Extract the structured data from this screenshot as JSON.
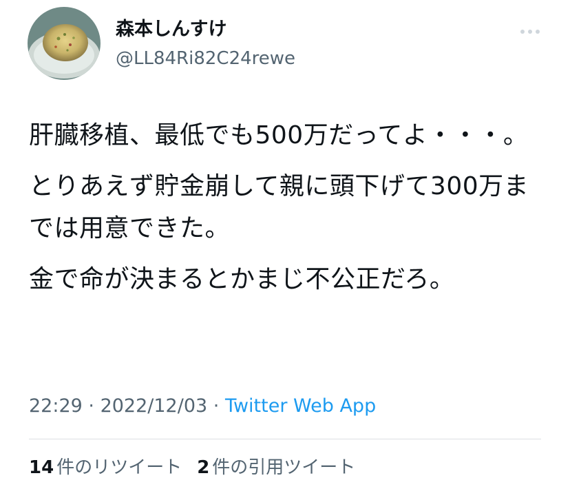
{
  "author": {
    "display_name": "森本しんすけ",
    "handle": "@LL84Ri82C24rewe",
    "avatar_icon": "fried-rice-plate-avatar"
  },
  "menu": {
    "more_icon": "more-dots-icon"
  },
  "tweet": {
    "paragraphs": [
      "肝臓移植、最低でも500万だってよ・・・。",
      "とりあえず貯金崩して親に頭下げて300万まで​は用意できた。",
      "金で命が決まるとかまじ不公正だろ。"
    ]
  },
  "meta": {
    "time": "22:29",
    "sep1": " · ",
    "date": "2022/12/03",
    "sep2": " · ",
    "source": "Twitter Web App"
  },
  "stats": {
    "retweets_count": "14",
    "retweets_label": "件のリツイート",
    "quotes_count": "2",
    "quotes_label": "件の引用ツイート"
  },
  "colors": {
    "text": "#0f1419",
    "secondary": "#536471",
    "link": "#1d9bf0",
    "divider": "#dcdfe3"
  }
}
